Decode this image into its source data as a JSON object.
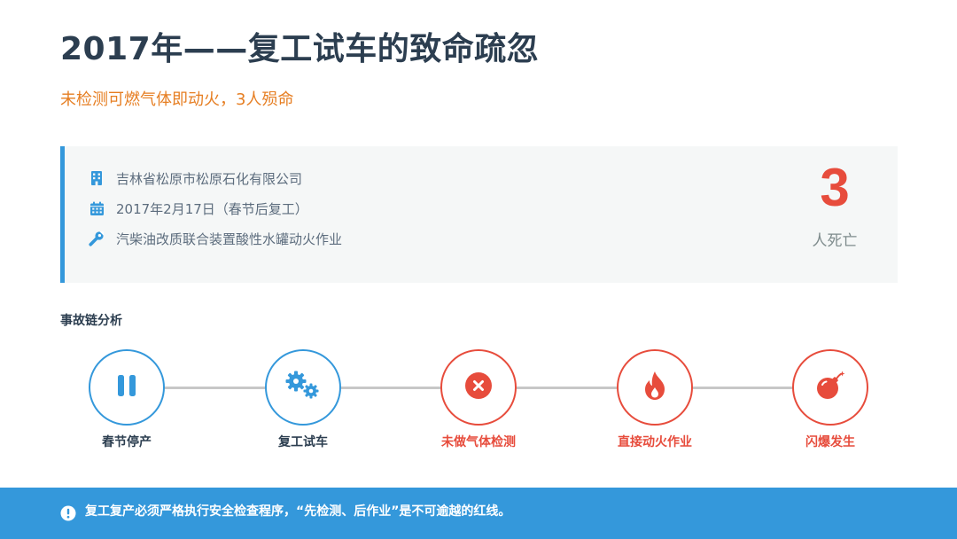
{
  "header": {
    "title": "2017年——复工试车的致命疏忽",
    "subtitle": "未检测可燃气体即动火，3人殒命"
  },
  "incident": {
    "company": "吉林省松原市松原石化有限公司",
    "date": "2017年2月17日（春节后复工）",
    "activity": "汽柴油改质联合装置酸性水罐动火作业",
    "deaths": "3",
    "deaths_label": "人死亡",
    "icons": [
      "building-icon",
      "calendar-icon",
      "wrench-icon"
    ]
  },
  "chain": {
    "title": "事故链分析",
    "nodes": [
      {
        "label": "春节停产",
        "icon": "pause-icon",
        "color": "#3498db"
      },
      {
        "label": "复工试车",
        "icon": "gears-icon",
        "color": "#3498db"
      },
      {
        "label": "未做气体检测",
        "icon": "x-circle-icon",
        "color": "#e74c3c"
      },
      {
        "label": "直接动火作业",
        "icon": "fire-icon",
        "color": "#e74c3c"
      },
      {
        "label": "闪爆发生",
        "icon": "bomb-icon",
        "color": "#e74c3c"
      }
    ]
  },
  "footer": {
    "text": "复工复产必须严格执行安全检查程序，“先检测、后作业”是不可逾越的红线。",
    "icon": "exclamation-circle-icon"
  },
  "colors": {
    "accent_blue": "#3498db",
    "alert_red": "#e74c3c",
    "subtitle_orange": "#e67e22",
    "title_dark": "#2c3e50"
  }
}
